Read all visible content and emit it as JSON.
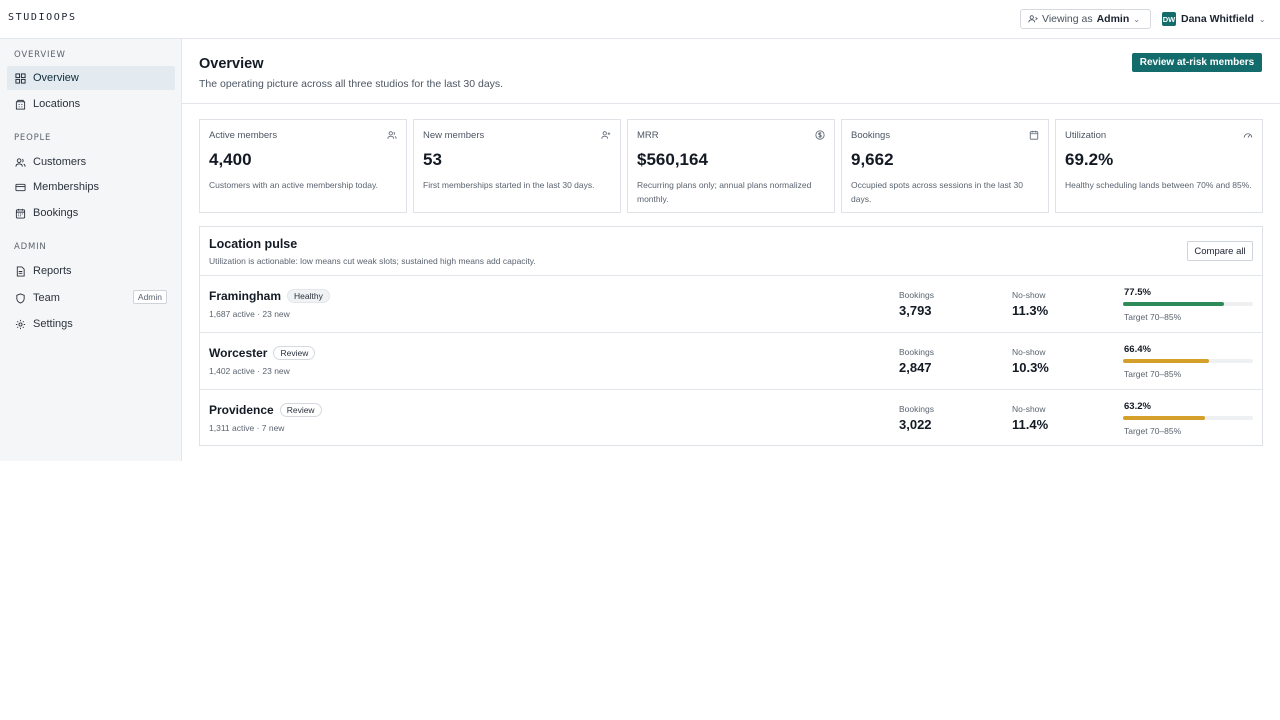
{
  "app": {
    "brand": "STUDIOOPS"
  },
  "topbar": {
    "viewing_prefix": "Viewing as",
    "viewing_role": "Admin",
    "user_initials": "DW",
    "user_name": "Dana Whitfield"
  },
  "sidebar": {
    "sections": [
      {
        "label": "OVERVIEW",
        "items": [
          {
            "label": "Overview",
            "icon": "grid-icon",
            "active": true
          },
          {
            "label": "Locations",
            "icon": "building-icon"
          }
        ]
      },
      {
        "label": "PEOPLE",
        "items": [
          {
            "label": "Customers",
            "icon": "users-icon"
          },
          {
            "label": "Memberships",
            "icon": "card-icon"
          },
          {
            "label": "Bookings",
            "icon": "calendar-icon"
          }
        ]
      },
      {
        "label": "ADMIN",
        "items": [
          {
            "label": "Reports",
            "icon": "document-icon"
          },
          {
            "label": "Team",
            "icon": "shield-icon",
            "badge": "Admin"
          },
          {
            "label": "Settings",
            "icon": "gear-icon"
          }
        ]
      }
    ]
  },
  "header": {
    "title": "Overview",
    "subtitle": "The operating picture across all three studios for the last 30 days.",
    "primary_action": "Review at-risk members"
  },
  "kpis": [
    {
      "label": "Active members",
      "icon": "users-icon",
      "value": "4,400",
      "desc": "Customers with an active membership today."
    },
    {
      "label": "New members",
      "icon": "user-plus-icon",
      "value": "53",
      "desc": "First memberships started in the last 30 days."
    },
    {
      "label": "MRR",
      "icon": "dollar-icon",
      "value": "$560,164",
      "desc": "Recurring plans only; annual plans normalized monthly."
    },
    {
      "label": "Bookings",
      "icon": "calendar-icon",
      "value": "9,662",
      "desc": "Occupied spots across sessions in the last 30 days."
    },
    {
      "label": "Utilization",
      "icon": "gauge-icon",
      "value": "69.2%",
      "desc": "Healthy scheduling lands between 70% and 85%."
    }
  ],
  "pulse": {
    "title": "Location pulse",
    "subtitle": "Utilization is actionable: low means cut weak slots; sustained high means add capacity.",
    "compare_label": "Compare all",
    "bookings_label": "Bookings",
    "noshow_label": "No-show",
    "colors": {
      "healthy": "#2e8b57",
      "review": "#d4a02a"
    },
    "locations": [
      {
        "name": "Framingham",
        "status": "Healthy",
        "meta": "1,687 active · 23 new",
        "bookings": "3,793",
        "noshow": "11.3%",
        "util_label": "77.5%",
        "util": 77.5,
        "target": "Target 70–85%"
      },
      {
        "name": "Worcester",
        "status": "Review",
        "meta": "1,402 active · 23 new",
        "bookings": "2,847",
        "noshow": "10.3%",
        "util_label": "66.4%",
        "util": 66.4,
        "target": "Target 70–85%"
      },
      {
        "name": "Providence",
        "status": "Review",
        "meta": "1,311 active · 7 new",
        "bookings": "3,022",
        "noshow": "11.4%",
        "util_label": "63.2%",
        "util": 63.2,
        "target": "Target 70–85%"
      }
    ]
  }
}
